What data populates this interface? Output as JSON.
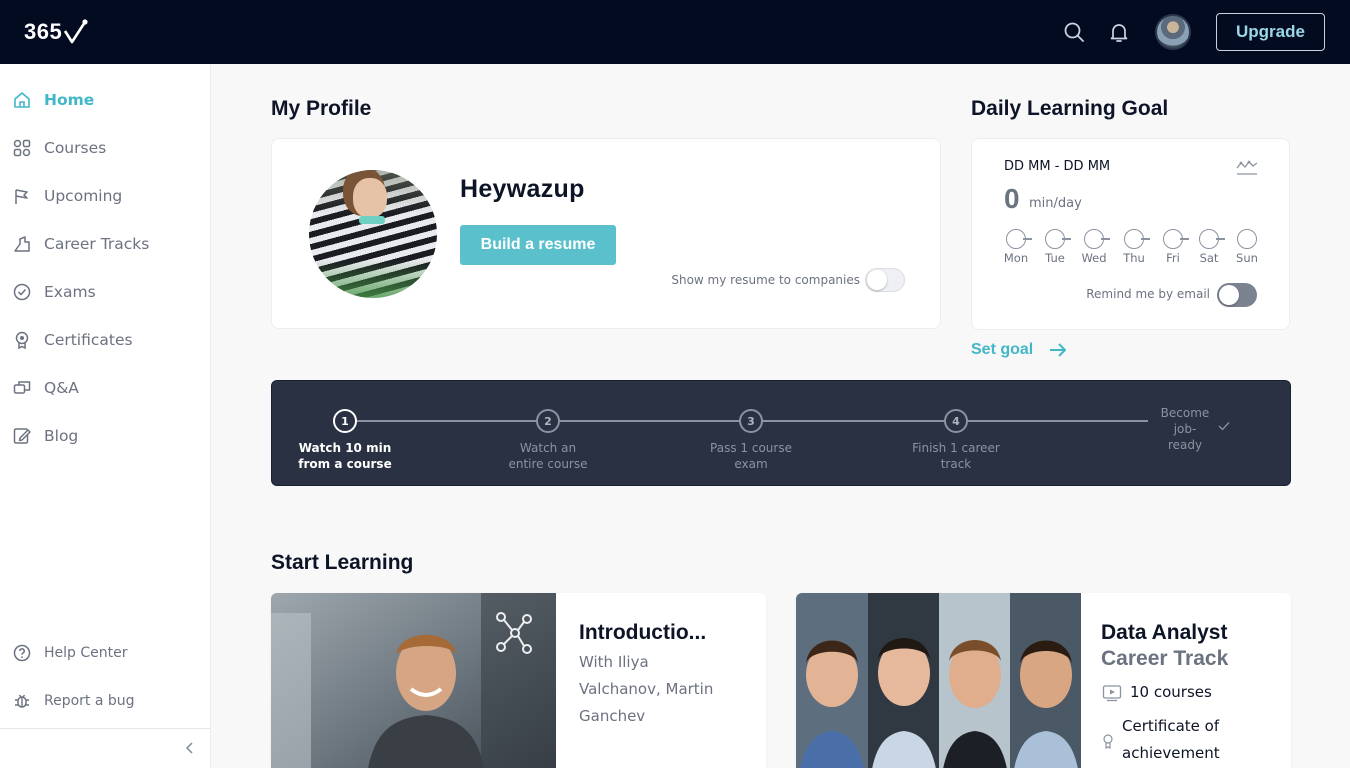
{
  "brand": {
    "logo_text": "365"
  },
  "header": {
    "upgrade_label": "Upgrade"
  },
  "sidebar": {
    "items": [
      {
        "label": "Home",
        "icon": "home-icon",
        "active": true
      },
      {
        "label": "Courses",
        "icon": "grid-icon"
      },
      {
        "label": "Upcoming",
        "icon": "flag-icon"
      },
      {
        "label": "Career Tracks",
        "icon": "career-icon"
      },
      {
        "label": "Exams",
        "icon": "check-circle-icon"
      },
      {
        "label": "Certificates",
        "icon": "award-icon"
      },
      {
        "label": "Q&A",
        "icon": "chat-icon"
      },
      {
        "label": "Blog",
        "icon": "edit-icon"
      }
    ],
    "footer": [
      {
        "label": "Help Center",
        "icon": "help-icon"
      },
      {
        "label": "Report a bug",
        "icon": "bug-icon"
      }
    ]
  },
  "profile": {
    "heading": "My Profile",
    "name": "Heywazup",
    "resume_button": "Build a resume",
    "show_resume_label": "Show my resume to companies",
    "show_resume_on": false
  },
  "goal": {
    "heading": "Daily Learning Goal",
    "range": "DD MM - DD MM",
    "value": "0",
    "unit": "min/day",
    "days": [
      "Mon",
      "Tue",
      "Wed",
      "Thu",
      "Fri",
      "Sat",
      "Sun"
    ],
    "remind_label": "Remind me by email",
    "remind_on": true,
    "set_goal_label": "Set goal"
  },
  "progress": {
    "steps": [
      {
        "num": "1",
        "line1": "Watch 10 min",
        "line2": "from a course",
        "active": true
      },
      {
        "num": "2",
        "line1": "Watch an",
        "line2": "entire course",
        "active": false
      },
      {
        "num": "3",
        "line1": "Pass 1 course",
        "line2": "exam",
        "active": false
      },
      {
        "num": "4",
        "line1": "Finish 1 career",
        "line2": "track",
        "active": false
      }
    ],
    "final": {
      "line1": "Become",
      "line2": "job-",
      "line3": "ready"
    }
  },
  "start_learning": {
    "heading": "Start Learning",
    "course": {
      "title": "Introductio...",
      "author_line1": "With Iliya",
      "author_line2": "Valchanov, Martin",
      "author_line3": "Ganchev"
    },
    "track": {
      "title": "Data Analyst",
      "subtitle": "Career Track",
      "courses": "10 courses",
      "cert_line1": "Certificate of",
      "cert_line2": "achievement"
    }
  },
  "colors": {
    "accent": "#42b7c8",
    "button": "#5ac0cb",
    "topbar": "#020b1f",
    "banner": "#2a3142"
  }
}
